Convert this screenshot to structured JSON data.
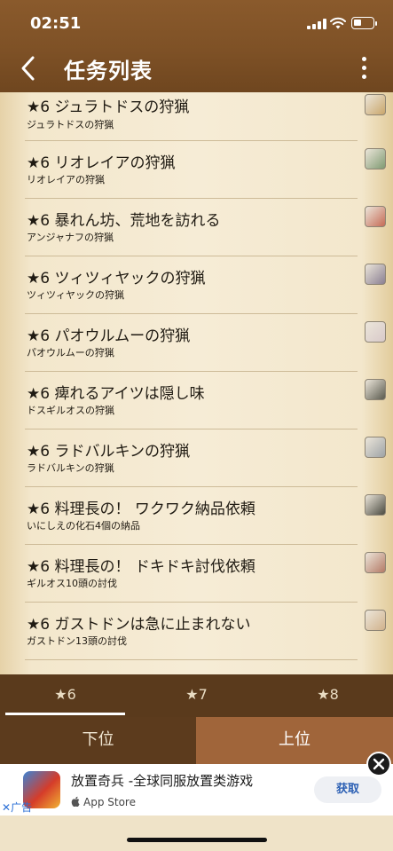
{
  "status_bar": {
    "time": "02:51"
  },
  "header": {
    "title": "任务列表",
    "back_icon": "chevron-left-icon",
    "more_icon": "more-vertical-icon"
  },
  "quests": [
    {
      "name": "★6 ジュラトドスの狩猟",
      "target": "ジュラトドスの狩猟",
      "icon_color": "#c9a66b"
    },
    {
      "name": "★6 リオレイアの狩猟",
      "target": "リオレイアの狩猟",
      "icon_color": "#7f9a72"
    },
    {
      "name": "★6 暴れん坊、荒地を訪れる",
      "target": "アンジャナフの狩猟",
      "icon_color": "#c56a55"
    },
    {
      "name": "★6 ツィツィヤックの狩猟",
      "target": "ツィツィヤックの狩猟",
      "icon_color": "#8a7f92"
    },
    {
      "name": "★6 パオウルムーの狩猟",
      "target": "パオウルムーの狩猟",
      "icon_color": "#d8c9c9"
    },
    {
      "name": "★6 痺れるアイツは隠し味",
      "target": "ドスギルオスの狩猟",
      "icon_color": "#5a5a4e"
    },
    {
      "name": "★6 ラドバルキンの狩猟",
      "target": "ラドバルキンの狩猟",
      "icon_color": "#9ea3a6"
    },
    {
      "name": "★6 料理長の！ ワクワク納品依頼",
      "target": "いにしえの化石4個の納品",
      "icon_color": "#4a4a40"
    },
    {
      "name": "★6 料理長の！ ドキドキ討伐依頼",
      "target": "ギルオス10頭の討伐",
      "icon_color": "#b47a66"
    },
    {
      "name": "★6 ガストドンは急に止まれない",
      "target": "ガストドン13頭の討伐",
      "icon_color": "#d1b28c"
    }
  ],
  "star_tabs": [
    {
      "label": "★6",
      "active": true
    },
    {
      "label": "★7",
      "active": false
    },
    {
      "label": "★8",
      "active": false
    }
  ],
  "rank_tabs": {
    "lower": "下位",
    "upper": "上位"
  },
  "ad": {
    "title": "放置奇兵 -全球同服放置类游戏",
    "store": "App Store",
    "get_label": "获取",
    "label": "广告"
  },
  "colors": {
    "header": "#7e5126",
    "tab_bar": "#5a3a1c",
    "upper_tab": "#a0653a",
    "lower_tab": "#5c3b1d"
  }
}
